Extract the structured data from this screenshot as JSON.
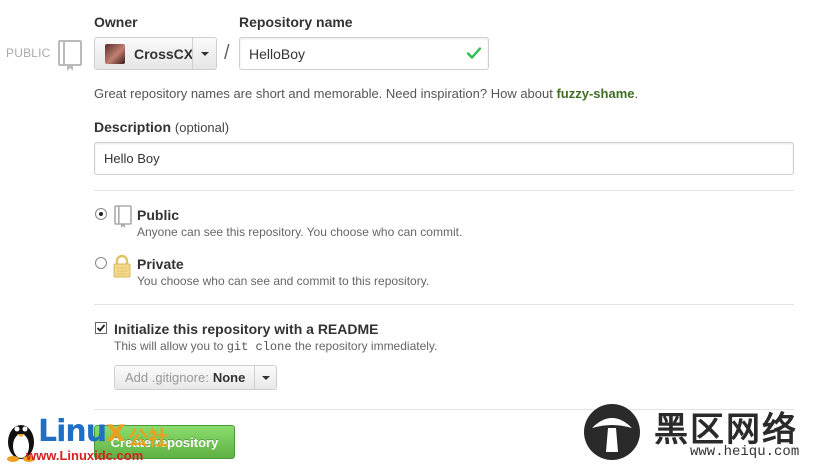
{
  "visibility_tag": "PUBLIC",
  "owner": {
    "label": "Owner",
    "name": "CrossCX"
  },
  "repo": {
    "label": "Repository name",
    "value": "HelloBoy",
    "separator": "/"
  },
  "hint": {
    "prefix": "Great repository names are short and memorable. Need inspiration? How about ",
    "suggestion": "fuzzy-shame",
    "suffix": "."
  },
  "description": {
    "label": "Description",
    "optional": "(optional)",
    "value": "Hello Boy"
  },
  "visibility": {
    "public": {
      "title": "Public",
      "desc": "Anyone can see this repository. You choose who can commit.",
      "selected": true
    },
    "private": {
      "title": "Private",
      "desc": "You choose who can see and commit to this repository.",
      "selected": false
    }
  },
  "readme": {
    "title": "Initialize this repository with a README",
    "desc_prefix": "This will allow you to ",
    "desc_code": "git clone",
    "desc_suffix": " the repository immediately.",
    "checked": true
  },
  "gitignore": {
    "label": "Add .gitignore:",
    "value": "None"
  },
  "create_button": {
    "label": "Create repository"
  },
  "watermarks": {
    "left": {
      "brand_a": "Linu",
      "brand_b": "x",
      "brand_cn": "公社",
      "url": "www.Linuxidc.com"
    },
    "right": {
      "cn": "黑区网络",
      "site": "www.heiqu.com"
    }
  },
  "colors": {
    "accent_green": "#60b044",
    "link_green": "#3e6e24",
    "check_green": "#2cbe4e"
  }
}
